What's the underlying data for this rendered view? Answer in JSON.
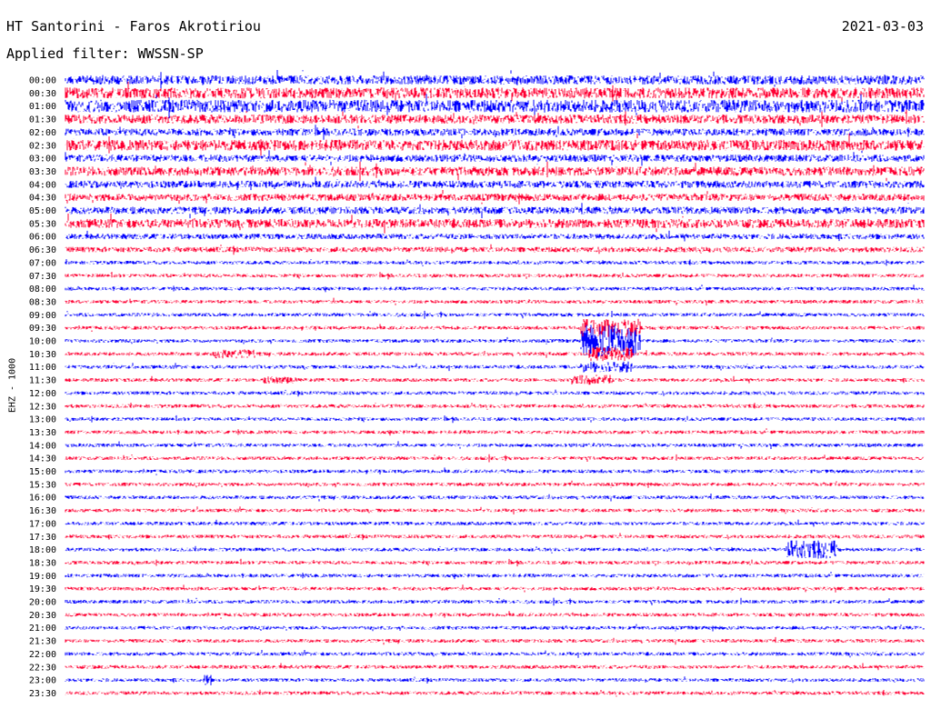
{
  "header": {
    "station": "HT Santorini - Faros Akrotiriou",
    "date": "2021-03-03",
    "filter": "Applied filter: WWSSN-SP"
  },
  "chart_data": {
    "type": "line",
    "title": "HT Santorini - Faros Akrotiriou",
    "ylabel": "EHZ - 1000",
    "colors": [
      "#0000ff",
      "#ff0033"
    ],
    "rows": [
      "00:00",
      "00:30",
      "01:00",
      "01:30",
      "02:00",
      "02:30",
      "03:00",
      "03:30",
      "04:00",
      "04:30",
      "05:00",
      "05:30",
      "06:00",
      "06:30",
      "07:00",
      "07:30",
      "08:00",
      "08:30",
      "09:00",
      "09:30",
      "10:00",
      "10:30",
      "11:00",
      "11:30",
      "12:00",
      "12:30",
      "13:00",
      "13:30",
      "14:00",
      "14:30",
      "15:00",
      "15:30",
      "16:00",
      "16:30",
      "17:00",
      "17:30",
      "18:00",
      "18:30",
      "19:00",
      "19:30",
      "20:00",
      "20:30",
      "21:00",
      "21:30",
      "22:00",
      "22:30",
      "23:00",
      "23:30"
    ],
    "noise_level": [
      5,
      6,
      7,
      5,
      4,
      6,
      4,
      5,
      4,
      4,
      4,
      5,
      3,
      3,
      2,
      2,
      2,
      2,
      2,
      2,
      2,
      2,
      2,
      2,
      2,
      2,
      2,
      2,
      2,
      2,
      2,
      2,
      2,
      2,
      2,
      2,
      2,
      2,
      2,
      2,
      2,
      2,
      2,
      2,
      2,
      2,
      2,
      2
    ],
    "events": [
      {
        "row": "10:00",
        "start": 0.6,
        "end": 0.67,
        "amplitude": 18
      },
      {
        "row": "09:30",
        "start": 0.6,
        "end": 0.67,
        "amplitude": 10
      },
      {
        "row": "10:30",
        "start": 0.61,
        "end": 0.66,
        "amplitude": 8
      },
      {
        "row": "11:00",
        "start": 0.6,
        "end": 0.66,
        "amplitude": 6
      },
      {
        "row": "11:30",
        "start": 0.59,
        "end": 0.64,
        "amplitude": 6
      },
      {
        "row": "10:30",
        "start": 0.17,
        "end": 0.22,
        "amplitude": 5
      },
      {
        "row": "11:30",
        "start": 0.23,
        "end": 0.27,
        "amplitude": 4
      },
      {
        "row": "18:00",
        "start": 0.84,
        "end": 0.9,
        "amplitude": 10
      },
      {
        "row": "23:00",
        "start": 0.16,
        "end": 0.17,
        "amplitude": 6
      }
    ]
  }
}
